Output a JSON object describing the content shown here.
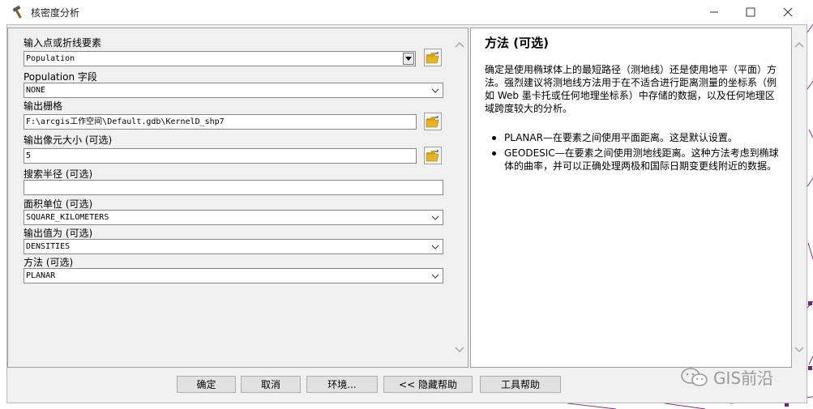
{
  "window": {
    "title": "核密度分析",
    "controls": {
      "minimize": "—",
      "maximize": "☐",
      "close": "✕"
    }
  },
  "form": {
    "input_features": {
      "label": "输入点或折线要素",
      "value": "Population"
    },
    "population_field": {
      "label": "Population 字段",
      "value": "NONE"
    },
    "output_raster": {
      "label": "输出栅格",
      "value": "F:\\arcgis工作空间\\Default.gdb\\KernelD_shp7"
    },
    "cell_size": {
      "label": "输出像元大小 (可选)",
      "value": "5"
    },
    "search_radius": {
      "label": "搜索半径 (可选)",
      "value": ""
    },
    "area_units": {
      "label": "面积单位 (可选)",
      "value": "SQUARE_KILOMETERS"
    },
    "output_values": {
      "label": "输出值为 (可选)",
      "value": "DENSITIES"
    },
    "method": {
      "label": "方法 (可选)",
      "value": "PLANAR"
    }
  },
  "help": {
    "title": "方法 (可选)",
    "description": "确定是使用椭球体上的最短路径（测地线）还是使用地平（平面）方法。强烈建议将测地线方法用于在不适合进行距离测量的坐标系（例如 Web 墨卡托或任何地理坐标系）中存储的数据，以及任何地理区域跨度较大的分析。",
    "bullets": [
      "PLANAR—在要素之间使用平面距离。这是默认设置。",
      "GEODESIC—在要素之间使用测地线距离。这种方法考虑到椭球体的曲率，并可以正确处理两极和国际日期变更线附近的数据。"
    ]
  },
  "buttons": {
    "ok": "确定",
    "cancel": "取消",
    "environments": "环境...",
    "hide_help": "<< 隐藏帮助",
    "tool_help": "工具帮助"
  },
  "watermark": {
    "text": "GIS前沿"
  },
  "colors": {
    "accent": "#7b1e7a",
    "map_line": "#8a2a8a",
    "folder": "#e6b422"
  }
}
